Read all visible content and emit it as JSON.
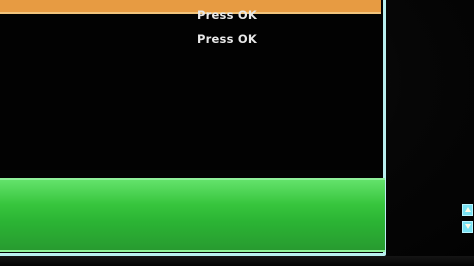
{
  "messages": [
    {
      "text": "Press OK"
    },
    {
      "text": "Press OK"
    }
  ],
  "theme": {
    "top_bar": "#e79b42",
    "frame": "#b9f0f0",
    "selection": "#37c53d",
    "scroll_indicator": "#79e2f3"
  },
  "icons": {
    "up": "up-arrow-icon",
    "down": "down-arrow-icon"
  }
}
